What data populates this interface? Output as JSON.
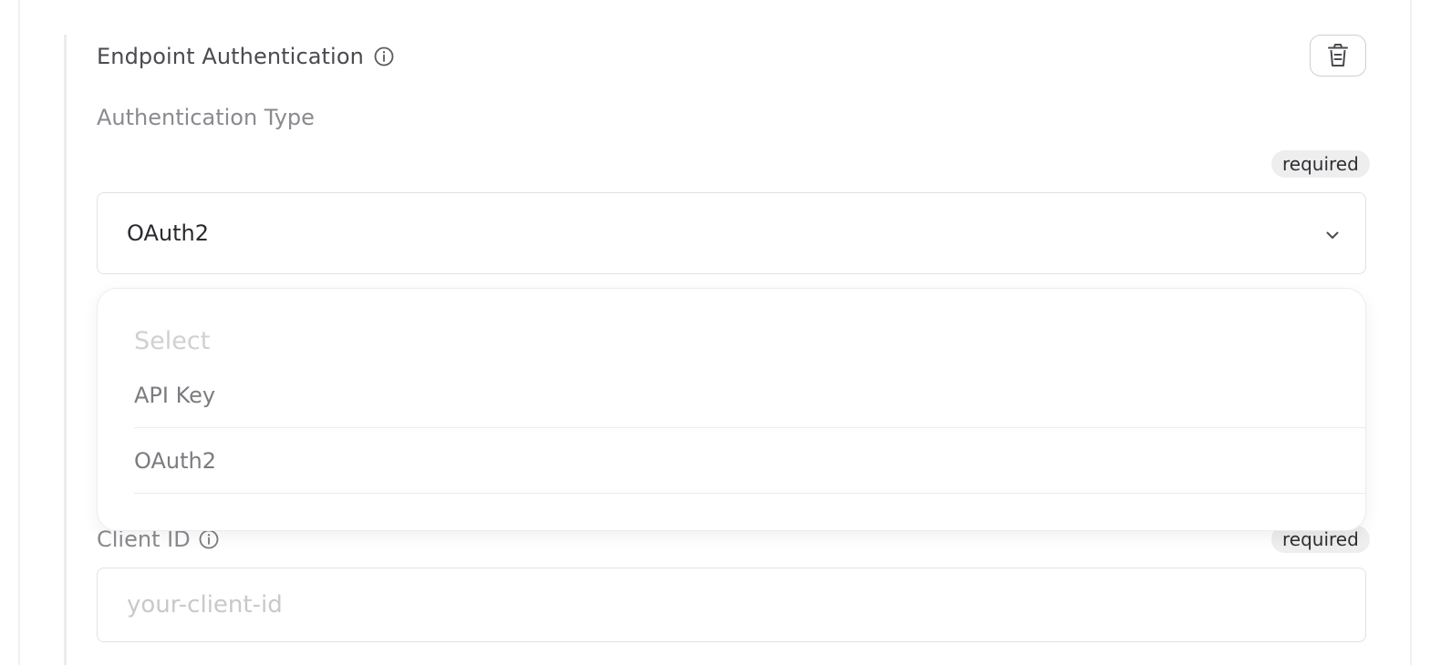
{
  "section": {
    "title": "Endpoint Authentication",
    "info_icon": "info-circle-icon",
    "delete_icon": "trash-icon"
  },
  "auth_type": {
    "label": "Authentication Type",
    "required_label": "required",
    "selected_value": "OAuth2",
    "chevron_icon": "chevron-down-icon"
  },
  "dropdown": {
    "placeholder": "Select",
    "options": [
      {
        "label": "API Key"
      },
      {
        "label": "OAuth2"
      }
    ]
  },
  "client_id": {
    "label": "Client ID",
    "info_icon": "info-circle-icon",
    "required_label": "required",
    "value": "",
    "placeholder": "your-client-id"
  },
  "colors": {
    "title_text": "#4a4a4f",
    "label_text": "#8a8a8f",
    "badge_bg": "#eeeeef",
    "border": "#e2e2e5"
  }
}
